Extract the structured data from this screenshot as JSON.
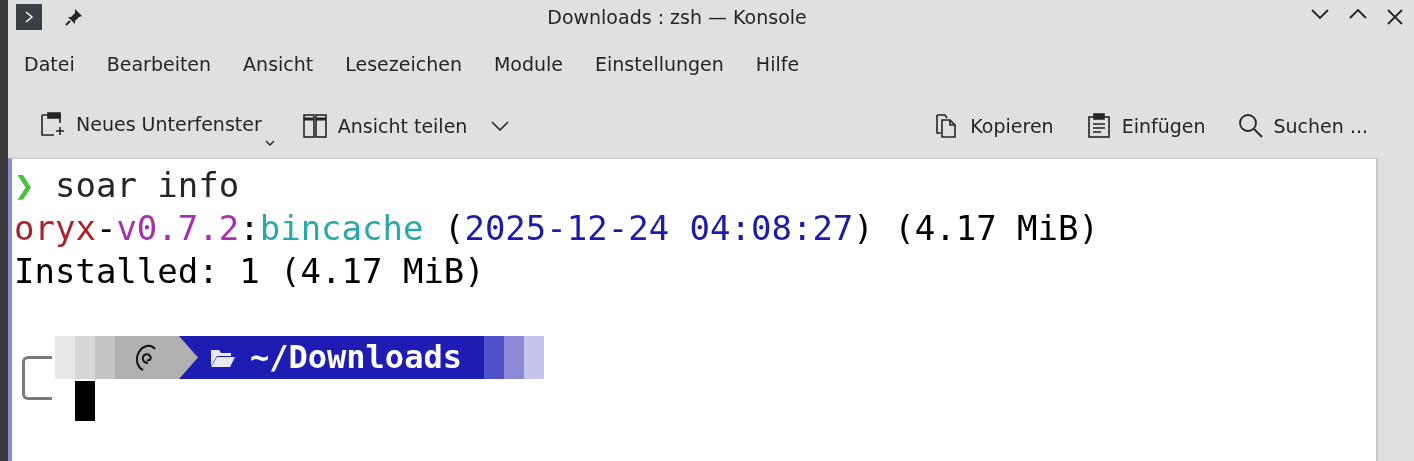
{
  "window": {
    "title": "Downloads : zsh — Konsole"
  },
  "menu": [
    "Datei",
    "Bearbeiten",
    "Ansicht",
    "Lesezeichen",
    "Module",
    "Einstellungen",
    "Hilfe"
  ],
  "toolbar_left": [
    {
      "label": "Neues Unterfenster",
      "kind": "menu"
    },
    {
      "label": "Ansicht teilen",
      "kind": "split"
    }
  ],
  "toolbar_right": [
    {
      "label": "Kopieren"
    },
    {
      "label": "Einfügen"
    },
    {
      "label": "Suchen ..."
    }
  ],
  "terminal": {
    "command": {
      "prompt_char": "❯",
      "text": "soar info"
    },
    "output": [
      {
        "segments": [
          {
            "text": "oryx",
            "color": "#a8232b"
          },
          {
            "text": "-",
            "color": "#000000"
          },
          {
            "text": "v0.7.2",
            "color": "#a82fb0"
          },
          {
            "text": ":",
            "color": "#000000"
          },
          {
            "text": "bincache",
            "color": "#2aa8a8"
          },
          {
            "text": " (",
            "color": "#000000"
          },
          {
            "text": "2025-12-24 04:08:27",
            "color": "#1c1ca8"
          },
          {
            "text": ") (4.17 MiB)",
            "color": "#000000"
          }
        ]
      },
      {
        "segments": [
          {
            "text": "Installed: 1 (4.17 MiB)",
            "color": "#000000"
          }
        ]
      }
    ],
    "prompt": {
      "path": "~/Downloads"
    }
  }
}
